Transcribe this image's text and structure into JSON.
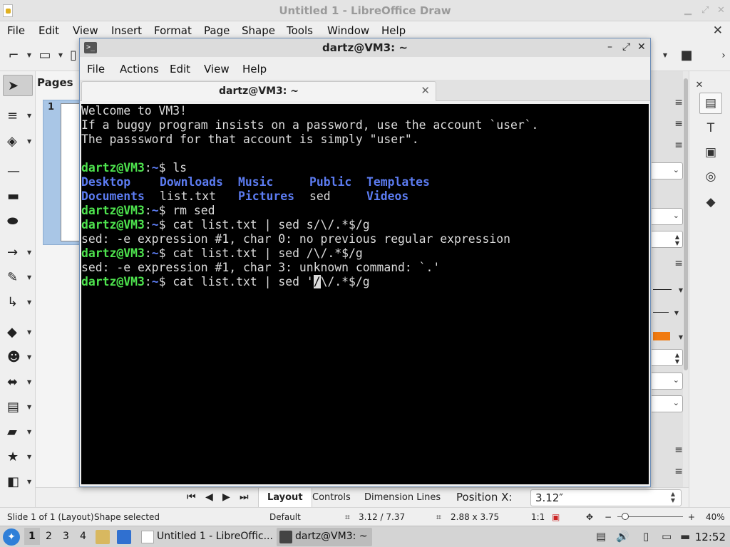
{
  "libreoffice": {
    "window_title": "Untitled 1 - LibreOffice Draw",
    "menus": [
      "File",
      "Edit",
      "View",
      "Insert",
      "Format",
      "Page",
      "Shape",
      "Tools",
      "Window",
      "Help"
    ],
    "pages_panel_title": "Pages",
    "page_number": "1",
    "bottom_tabs": [
      "Layout",
      "Controls",
      "Dimension Lines"
    ],
    "position_label": "Position X:",
    "position_value": "3.12″",
    "status": {
      "slide": "Slide 1 of 1 (Layout)",
      "selection": "Shape selected",
      "master": "Default",
      "position": "3.12 / 7.37",
      "size": "2.88 x 3.75",
      "scale": "1:1",
      "zoom": "40%"
    }
  },
  "terminal": {
    "window_title": "dartz@VM3: ~",
    "menus": [
      "File",
      "Actions",
      "Edit",
      "View",
      "Help"
    ],
    "tab_title": "dartz@VM3: ~",
    "motd": [
      "Welcome to VM3!",
      "If a buggy program insists on a password, use the account `user`.",
      "The passsword for that account is simply \"user\"."
    ],
    "prompt_user": "dartz@VM3",
    "prompt_path": "~",
    "commands": [
      "ls",
      "rm sed",
      "cat list.txt | sed s/\\/.*$/g",
      "cat list.txt | sed /\\/.*$/g"
    ],
    "ls_row1": [
      "Desktop",
      "Downloads",
      "Music",
      "Public",
      "Templates"
    ],
    "ls_row2": [
      "Documents",
      "list.txt",
      "Pictures",
      "sed",
      "Videos"
    ],
    "errors": [
      "sed: -e expression #1, char 0: no previous regular expression",
      "sed: -e expression #1, char 3: unknown command: `.'"
    ],
    "current_input_before": "cat list.txt | sed '",
    "current_input_cursor": "/",
    "current_input_after": "\\/.*$/g"
  },
  "taskbar": {
    "workspaces": [
      "1",
      "2",
      "3",
      "4"
    ],
    "tasks": [
      "Untitled 1 - LibreOffic...",
      "dartz@VM3: ~"
    ],
    "clock": "12:52"
  }
}
